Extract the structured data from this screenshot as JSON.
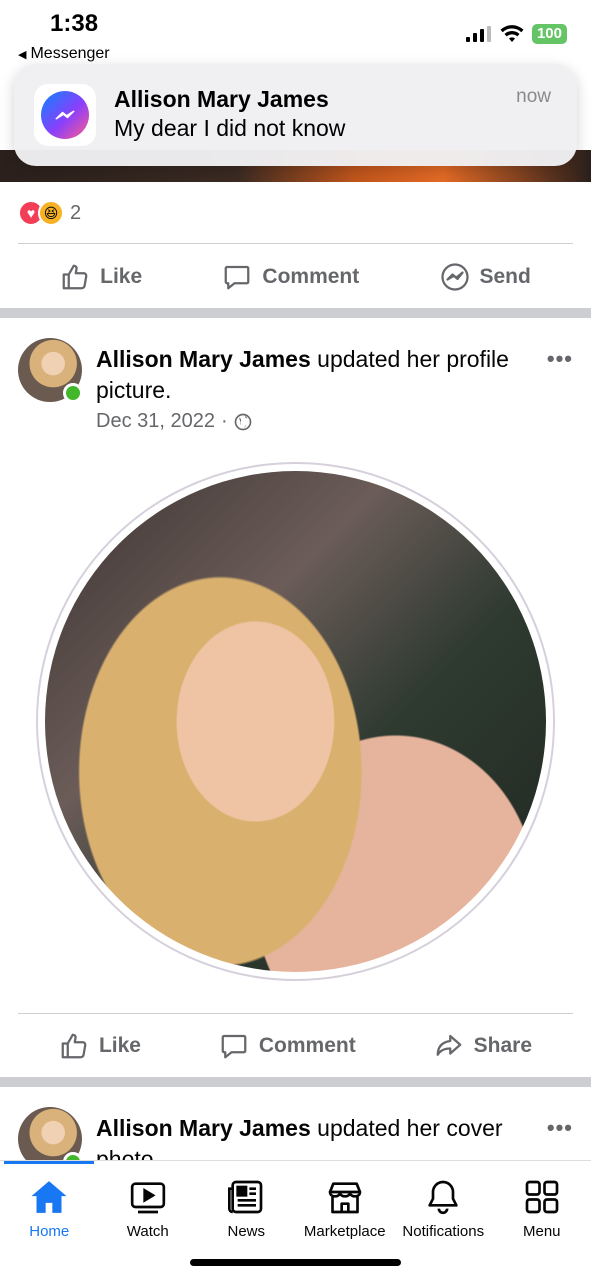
{
  "status_bar": {
    "time": "1:38",
    "back_app": "Messenger",
    "battery": "100"
  },
  "notification": {
    "sender": "Allison Mary James",
    "message": "My dear I did not know",
    "time": "now",
    "app_icon": "messenger-icon"
  },
  "prev_post": {
    "reaction_count": "2",
    "reactions": [
      "love",
      "haha"
    ]
  },
  "actions_1": {
    "like": "Like",
    "comment": "Comment",
    "send": "Send"
  },
  "post": {
    "author": "Allison Mary James",
    "action_text": " updated her profile picture.",
    "date": "Dec 31, 2022",
    "privacy_icon": "globe-icon",
    "more": "•••"
  },
  "actions_2": {
    "like": "Like",
    "comment": "Comment",
    "share": "Share"
  },
  "next_post": {
    "author": "Allison Mary James",
    "action_text": " updated her cover photo",
    "more": "•••"
  },
  "tabs": [
    {
      "label": "Home",
      "icon": "home-icon",
      "active": true
    },
    {
      "label": "Watch",
      "icon": "watch-icon"
    },
    {
      "label": "News",
      "icon": "news-icon"
    },
    {
      "label": "Marketplace",
      "icon": "marketplace-icon"
    },
    {
      "label": "Notifications",
      "icon": "bell-icon"
    },
    {
      "label": "Menu",
      "icon": "menu-icon"
    }
  ],
  "colors": {
    "accent": "#1877f2",
    "online": "#42b72a",
    "battery": "#65c466"
  }
}
